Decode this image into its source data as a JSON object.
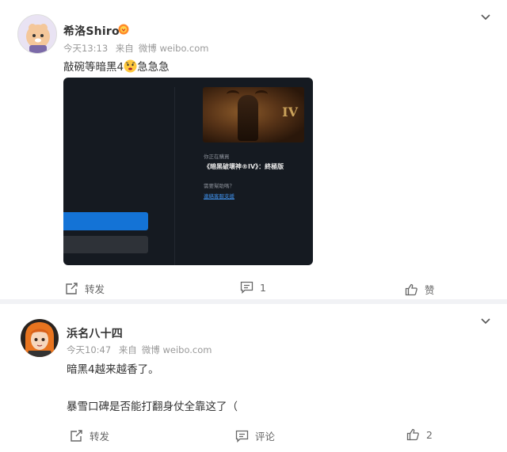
{
  "posts": [
    {
      "username": "希洛Shiro",
      "time": "今天13:13",
      "source_prefix": "来自",
      "source": "微博 weibo.com",
      "text_before_emoji": "敲碗等暗黑4",
      "text_after_emoji": "急急急",
      "screenshot": {
        "label_small": "你正在購買",
        "title": "《暗黑破壞神®IV》：終極版",
        "question": "需要幫助嗎？",
        "link": "連絡客服支援"
      },
      "actions": {
        "repost_label": "转发",
        "comment_count": "1",
        "like_label": "赞"
      }
    },
    {
      "username": "浜名八十四",
      "time": "今天10:47",
      "source_prefix": "来自",
      "source": "微博 weibo.com",
      "line1": "暗黑4越来越香了。",
      "line2": "暴雪口碑是否能打翻身仗全靠这了（",
      "actions": {
        "repost_label": "转发",
        "comment_label": "评论",
        "like_count": "2"
      }
    }
  ],
  "colors": {
    "page_bg": "#f1f2f5",
    "card_bg": "#ffffff",
    "meta_gray": "#999999",
    "accent_blue": "#1473d6",
    "emoji_yellow": "#ffc83d"
  }
}
